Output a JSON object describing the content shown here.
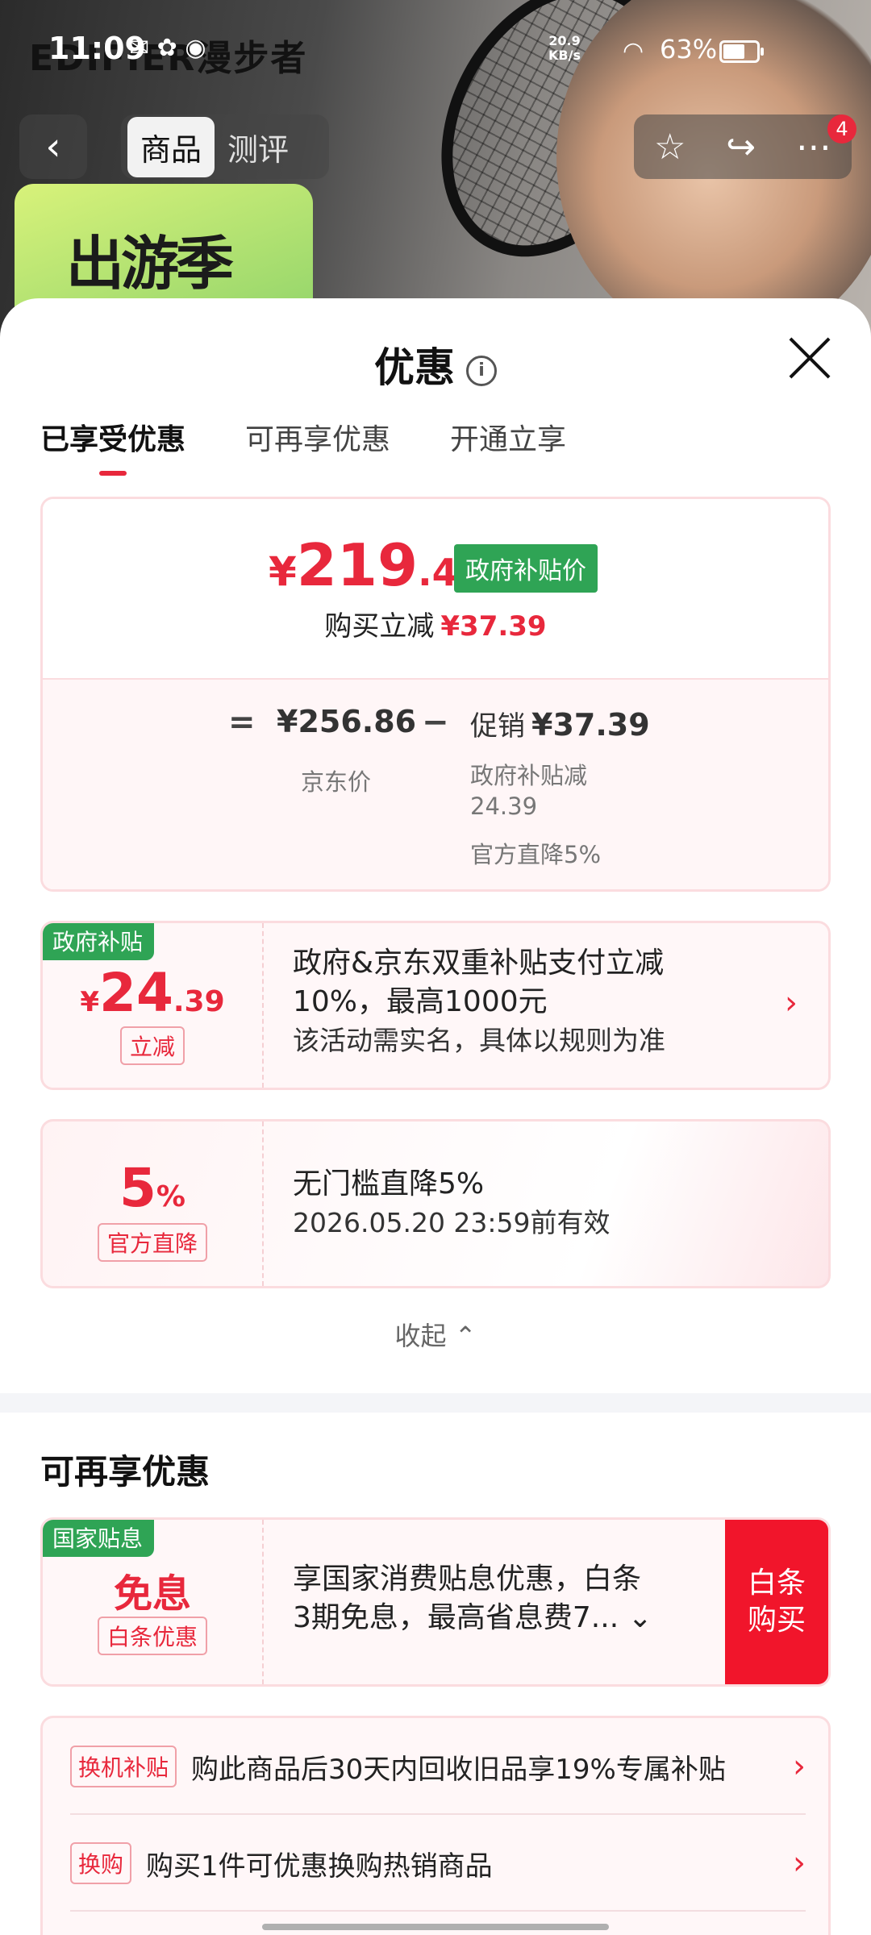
{
  "status_bar": {
    "time": "11:09",
    "net_speed": "20.9",
    "net_unit": "KB/s",
    "battery": "63%"
  },
  "banner": {
    "brand": "EDIFIER漫步者",
    "promo": "出游季"
  },
  "nav": {
    "back": "‹",
    "tabs": [
      "商品",
      "测评"
    ],
    "badge_count": "4"
  },
  "sheet": {
    "title": "优惠",
    "tabs": [
      "已享受优惠",
      "可再享优惠",
      "开通立享"
    ]
  },
  "price_card": {
    "currency": "¥",
    "price_int": "219",
    "price_dec": ".47",
    "gov_tag": "政府补贴价",
    "reduce_label": "购买立减",
    "reduce_amount": "¥37.39",
    "eq": "=",
    "minus": "−",
    "jd_price": "¥256.86",
    "jd_label": "京东价",
    "promo_label": "促销",
    "promo_amount": "¥37.39",
    "sub_line1": "政府补贴减",
    "sub_line1b": "24.39",
    "sub_line2": "官方直降5%"
  },
  "coupons": [
    {
      "corner": "政府补贴",
      "currency": "¥",
      "value_int": "24",
      "value_dec": ".39",
      "tag": "立减",
      "desc_line1": "政府&京东双重补贴支付立减",
      "desc_line2": "10%，最高1000元",
      "desc_line3": "该活动需实名，具体以规则为准"
    },
    {
      "value_int": "5",
      "value_unit": "%",
      "tag": "官方直降",
      "desc_line1": "无门槛直降5%",
      "desc_line2": "2026.05.20 23:59前有效"
    }
  ],
  "collapse_label": "收起",
  "more_section": {
    "title": "可再享优惠",
    "coupon": {
      "corner": "国家贴息",
      "value": "免息",
      "tag": "白条优惠",
      "desc_line1": "享国家消费贴息优惠，白条",
      "desc_line2": "3期免息，最高省息费7...",
      "button_line1": "白条",
      "button_line2": "购买"
    },
    "rows": [
      {
        "tag": "换机补贴",
        "text": "购此商品后30天内回收旧品享19%专属补贴"
      },
      {
        "tag": "换购",
        "text": "购买1件可优惠换购热销商品"
      }
    ]
  },
  "colors": {
    "accent_red": "#e8283c",
    "gov_green": "#2fa455",
    "buy_button": "#f1152b"
  }
}
